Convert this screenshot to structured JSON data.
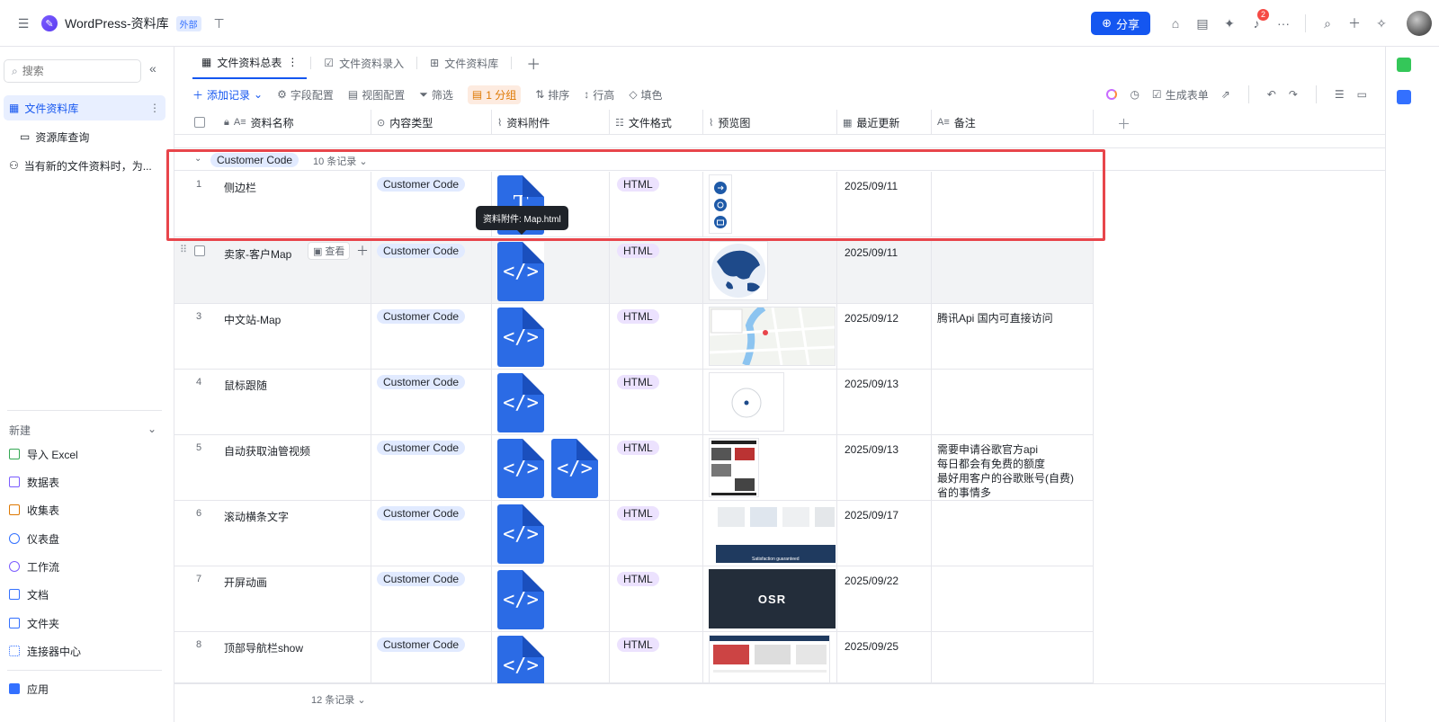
{
  "app": {
    "title": "WordPress-资料库",
    "tag": "外部"
  },
  "topbar": {
    "share_label": "分享",
    "notification_count": "2"
  },
  "sidebar": {
    "search_placeholder": "搜索",
    "items": [
      {
        "label": "文件资料库",
        "active": true
      },
      {
        "label": "资源库查询"
      },
      {
        "label": "当有新的文件资料时，为..."
      }
    ],
    "new_header": "新建",
    "new_items": [
      {
        "label": "导入 Excel",
        "color": "#34a853"
      },
      {
        "label": "数据表",
        "color": "#7b5cff"
      },
      {
        "label": "收集表",
        "color": "#de7802"
      },
      {
        "label": "仪表盘",
        "color": "#3370ff"
      },
      {
        "label": "工作流",
        "color": "#7b5cff"
      },
      {
        "label": "文档",
        "color": "#3370ff"
      },
      {
        "label": "文件夹",
        "color": "#3370ff"
      },
      {
        "label": "连接器中心",
        "color": "#3370ff"
      }
    ],
    "apps_label": "应用"
  },
  "tabs": [
    {
      "label": "文件资料总表",
      "active": true
    },
    {
      "label": "文件资料录入"
    },
    {
      "label": "文件资料库"
    }
  ],
  "toolbar": {
    "add_record": "添加记录",
    "field_config": "字段配置",
    "view_config": "视图配置",
    "filter": "筛选",
    "group": "1 分组",
    "sort": "排序",
    "row_height": "行高",
    "fill_color": "填色",
    "generate_form": "生成表单"
  },
  "columns": [
    "资料名称",
    "内容类型",
    "资料附件",
    "文件格式",
    "预览图",
    "最近更新",
    "备注"
  ],
  "group": {
    "name": "Customer Code",
    "count": "10 条记录"
  },
  "tooltip": "资料附件: Map.html",
  "view_label": "查看",
  "rows": [
    {
      "num": "1",
      "name": "侧边栏",
      "type": "Customer Code",
      "format": "HTML",
      "date": "2025/09/11",
      "note": [],
      "files": 1,
      "file_kind": "doc"
    },
    {
      "num": "",
      "name": "卖家-客户Map",
      "type": "Customer Code",
      "format": "HTML",
      "date": "2025/09/11",
      "note": [],
      "files": 1,
      "file_kind": "code"
    },
    {
      "num": "3",
      "name": "中文站-Map",
      "type": "Customer Code",
      "format": "HTML",
      "date": "2025/09/12",
      "note": [
        "腾讯Api 国内可直接访问"
      ],
      "files": 1,
      "file_kind": "code"
    },
    {
      "num": "4",
      "name": "鼠标跟随",
      "type": "Customer Code",
      "format": "HTML",
      "date": "2025/09/13",
      "note": [],
      "files": 1,
      "file_kind": "code"
    },
    {
      "num": "5",
      "name": "自动获取油管视频",
      "type": "Customer Code",
      "format": "HTML",
      "date": "2025/09/13",
      "note": [
        "需要申请谷歌官方api",
        "每日都会有免费的额度",
        "最好用客户的谷歌账号(自费)",
        "省的事情多"
      ],
      "files": 2,
      "file_kind": "code"
    },
    {
      "num": "6",
      "name": "滚动横条文字",
      "type": "Customer Code",
      "format": "HTML",
      "date": "2025/09/17",
      "note": [],
      "files": 1,
      "file_kind": "code"
    },
    {
      "num": "7",
      "name": "开屏动画",
      "type": "Customer Code",
      "format": "HTML",
      "date": "2025/09/22",
      "note": [],
      "files": 1,
      "file_kind": "code"
    },
    {
      "num": "8",
      "name": "顶部导航栏show",
      "type": "Customer Code",
      "format": "HTML",
      "date": "2025/09/25",
      "note": [],
      "files": 1,
      "file_kind": "code"
    }
  ],
  "preview_text": {
    "osr": "OSR",
    "satisfaction": "Satisfaction guaranteed"
  },
  "footer_count": "12 条记录"
}
